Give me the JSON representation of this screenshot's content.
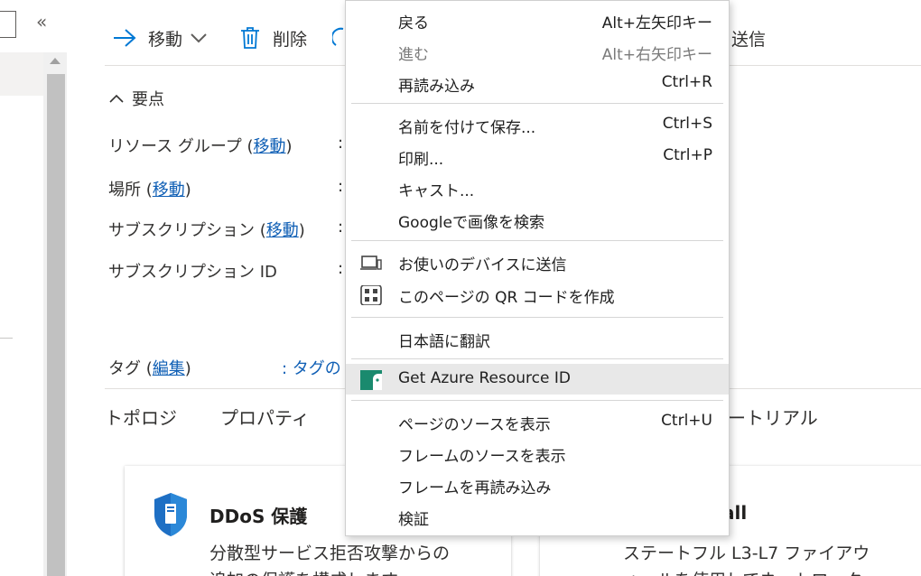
{
  "toolbar": {
    "move_label": "移動",
    "delete_label": "削除",
    "feedback_label": "送信"
  },
  "essentials": {
    "header": "要点",
    "resource_group": {
      "label": "リソース グループ (",
      "link": "移動",
      "close": ")"
    },
    "location": {
      "label": "場所 (",
      "link": "移動",
      "close": ")"
    },
    "subscription": {
      "label": "サブスクリプション (",
      "link": "移動",
      "close": ")"
    },
    "subscription_id": {
      "label": "サブスクリプション ID"
    },
    "colon": ":",
    "tags": {
      "label": "タグ (",
      "link": "編集",
      "close": ")",
      "value": ": タグの"
    }
  },
  "tabs": [
    "トポロジ",
    "プロパティ",
    "ートリアル"
  ],
  "cards": [
    {
      "title": "DDoS 保護",
      "desc1": "分散型サービス拒否攻撃からの",
      "desc2": "追加の保護を構成します"
    },
    {
      "title": "all",
      "desc1": "ステートフル L3-L7 ファイアウ",
      "desc2": "ォールを使用してネットワーク"
    }
  ],
  "context_menu": {
    "items": [
      {
        "label": "戻る",
        "shortcut": "Alt+左矢印キー",
        "disabled": false
      },
      {
        "label": "進む",
        "shortcut": "Alt+右矢印キー",
        "disabled": true
      },
      {
        "label": "再読み込み",
        "shortcut": "Ctrl+R",
        "disabled": false
      },
      {
        "label": "名前を付けて保存...",
        "shortcut": "Ctrl+S",
        "disabled": false
      },
      {
        "label": "印刷...",
        "shortcut": "Ctrl+P",
        "disabled": false
      },
      {
        "label": "キャスト...",
        "shortcut": "",
        "disabled": false
      },
      {
        "label": "Googleで画像を検索",
        "shortcut": "",
        "disabled": false
      },
      {
        "label": "お使いのデバイスに送信",
        "shortcut": "",
        "icon": "device-send-icon"
      },
      {
        "label": "このページの QR コードを作成",
        "shortcut": "",
        "icon": "qr-code-icon"
      },
      {
        "label": "日本語に翻訳",
        "shortcut": ""
      },
      {
        "label": "Get Azure Resource ID",
        "shortcut": "",
        "icon": "azure-extension-icon",
        "highlighted": true
      },
      {
        "label": "ページのソースを表示",
        "shortcut": "Ctrl+U"
      },
      {
        "label": "フレームのソースを表示",
        "shortcut": ""
      },
      {
        "label": "フレームを再読み込み",
        "shortcut": ""
      },
      {
        "label": "検証",
        "shortcut": ""
      }
    ]
  },
  "colors": {
    "link": "#0f5fb5",
    "accent": "#0078d4",
    "menu_highlight": "#e8e8e8",
    "extension_icon": "#1a8a6e"
  }
}
